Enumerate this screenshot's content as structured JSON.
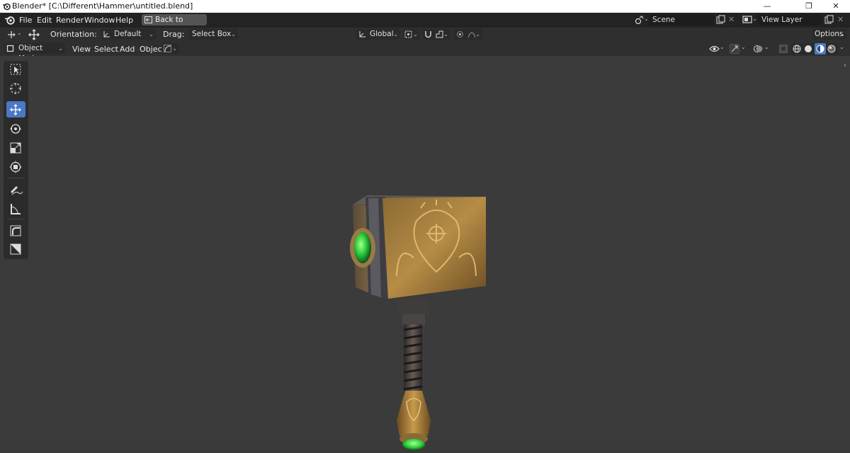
{
  "window": {
    "title": "Blender* [C:\\Different\\Hammer\\untitled.blend]",
    "controls": {
      "minimize": "—",
      "maximize": "❐",
      "close": "✕"
    }
  },
  "menubar": {
    "items": [
      "File",
      "Edit",
      "Render",
      "Window",
      "Help"
    ],
    "back_button": "Back to Previous",
    "scene": "Scene",
    "view_layer": "View Layer"
  },
  "toolsettings": {
    "orientation_label": "Orientation:",
    "orientation_value": "Default",
    "drag_label": "Drag:",
    "drag_value": "Select Box",
    "transform_orientation": "Global",
    "options": "Options"
  },
  "header": {
    "mode": "Object Mode",
    "menus": [
      "View",
      "Select",
      "Add",
      "Object"
    ]
  },
  "tools": [
    {
      "name": "select-box-tool",
      "active": false
    },
    {
      "name": "cursor-tool",
      "active": false
    },
    {
      "name": "move-tool",
      "active": true
    },
    {
      "name": "rotate-tool",
      "active": false
    },
    {
      "name": "scale-tool",
      "active": false
    },
    {
      "name": "transform-tool",
      "active": false
    },
    {
      "name": "annotate-tool",
      "active": false
    },
    {
      "name": "measure-tool",
      "active": false
    },
    {
      "name": "add-cube-tool",
      "active": false
    },
    {
      "name": "add-plane-tool",
      "active": false
    }
  ],
  "colors": {
    "accent": "#4a78c4",
    "viewport_bg": "#3b3b3b",
    "gem_green": "#35e04a",
    "metal_gold": "#b88a3c"
  }
}
